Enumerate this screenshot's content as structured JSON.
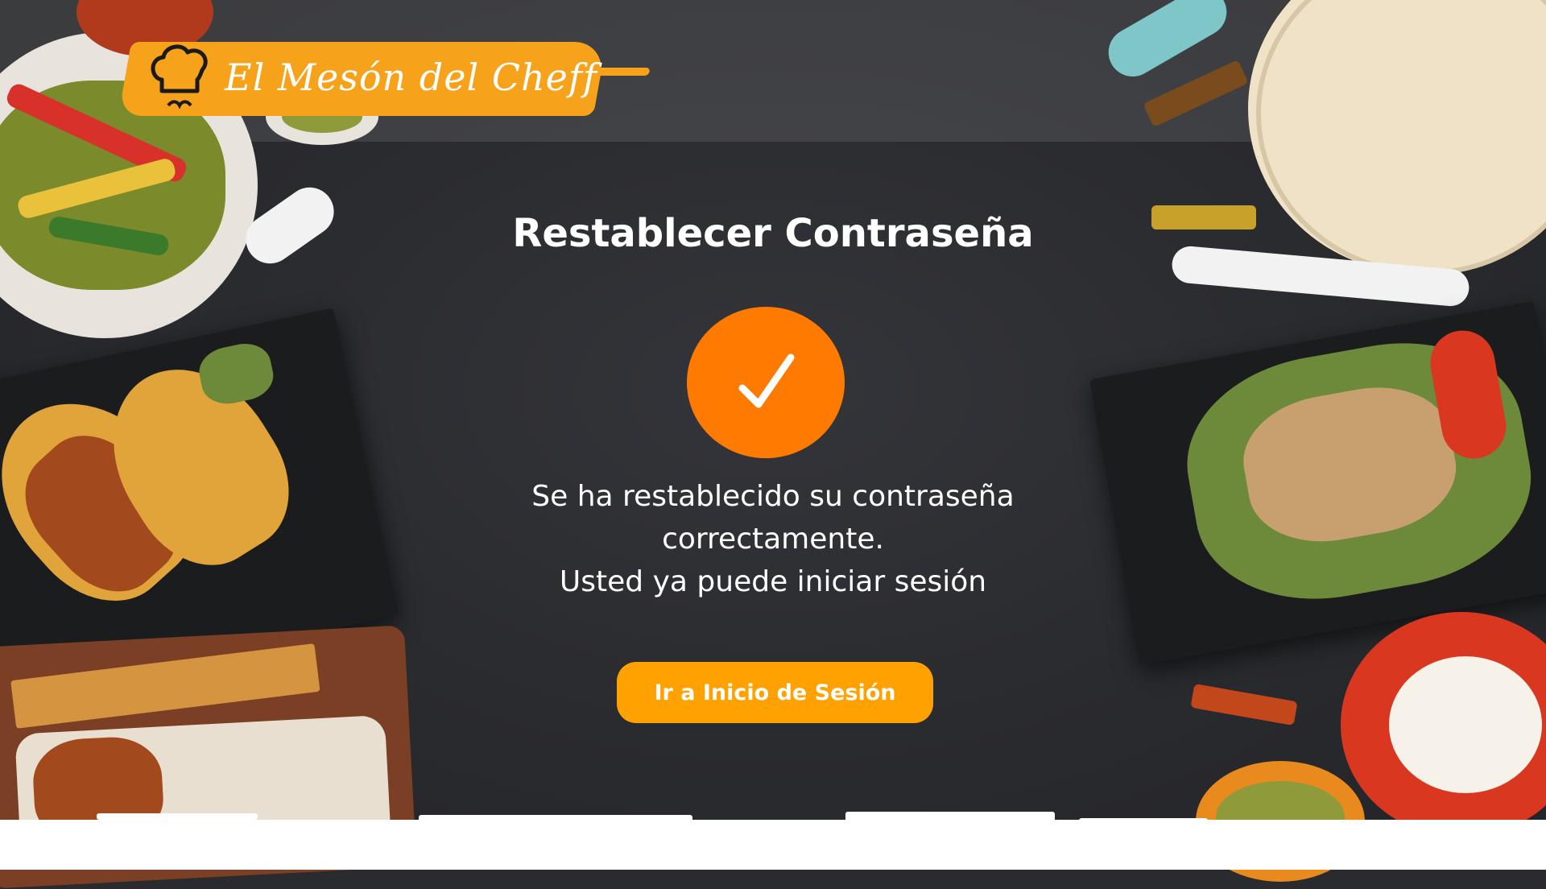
{
  "brand": {
    "name": "El Mesón del Cheff",
    "logo_icon": "chef-hat-icon",
    "accent_color": "#f7a21b"
  },
  "reset": {
    "title": "Restablecer Contraseña",
    "status_icon": "check-icon",
    "status_color": "#ff7a00",
    "message_line1": "Se ha restablecido su contraseña",
    "message_line2": "correctamente.",
    "message_line3": "Usted ya puede iniciar sesión",
    "button_label": "Ir a Inicio de Sesión",
    "button_color": "#ffa100"
  }
}
